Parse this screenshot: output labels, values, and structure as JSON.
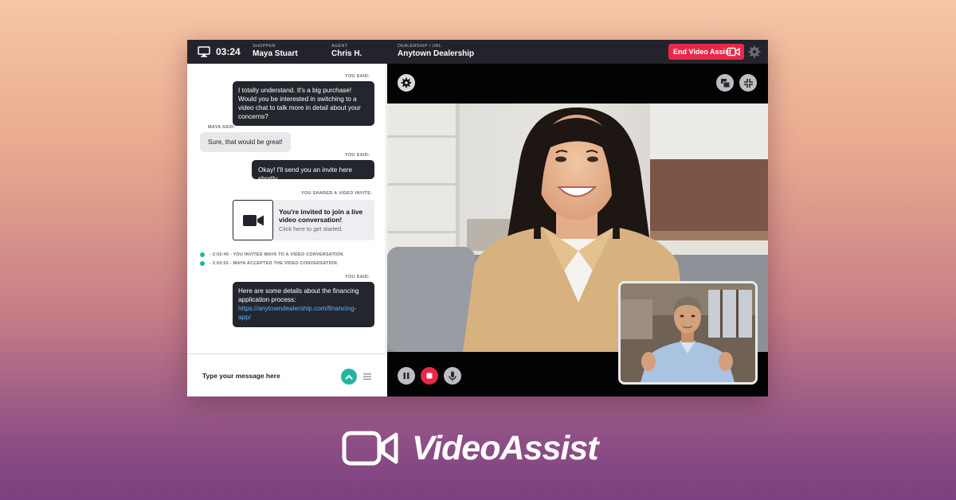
{
  "topbar": {
    "timer": "03:24",
    "shopper_label": "SHOPPER",
    "shopper_name": "Maya Stuart",
    "agent_label": "AGENT",
    "agent_name": "Chris H.",
    "dealership_label": "DEALERSHIP / URL",
    "dealership_name": "Anytown Dealership",
    "end_button": "End Video Assist"
  },
  "chat": {
    "messages": [
      {
        "label": "YOU SAID:",
        "text": "I totally understand. It's a big purchase! Would you be interested in switching to a video chat to talk more in detail about your concerns?"
      },
      {
        "label": "MAYA SAID:",
        "text": "Sure, that would be great!"
      },
      {
        "label": "YOU SAID:",
        "text": "Okay! I'll send you an invite here shortly."
      },
      {
        "label": "YOU SHARED A VIDEO INVITE:"
      },
      {
        "label": "YOU SAID:",
        "text": "Here are some details about the financing application process:",
        "link": "https://anytowndealership.com/financing-app/"
      }
    ],
    "invite": {
      "title": "You're invited to join a live video conversation!",
      "subtitle": "Click here to get started."
    },
    "logs": [
      "- 2:02:45 - YOU INVITED MAYA TO A VIDEO CONVERSATION.",
      "- 2:03:02 - MAYA ACCEPTED THE VIDEO CONVERSATION."
    ],
    "composer_placeholder": "Type your message here"
  },
  "brand": {
    "name": "VideoAssist"
  },
  "colors": {
    "accent_red": "#e8284a",
    "accent_teal": "#23b5a2",
    "dark_bar": "#23242b"
  }
}
